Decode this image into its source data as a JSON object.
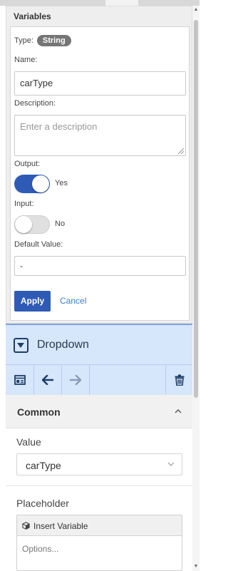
{
  "variables": {
    "section_title": "Variables",
    "type_label": "Type:",
    "type_value": "String",
    "name_label": "Name:",
    "name_value": "carType",
    "description_label": "Description:",
    "description_placeholder": "Enter a description",
    "output_label": "Output:",
    "output_state": "Yes",
    "input_label": "Input:",
    "input_state": "No",
    "default_label": "Default Value:",
    "default_value": "-",
    "apply_label": "Apply",
    "cancel_label": "Cancel"
  },
  "widget": {
    "title": "Dropdown",
    "icon": "dropdown-icon",
    "toolbar": [
      {
        "icon": "properties-icon"
      },
      {
        "icon": "arrow-left-icon"
      },
      {
        "icon": "arrow-right-icon"
      },
      {
        "icon": "trash-icon"
      }
    ]
  },
  "common": {
    "title": "Common",
    "value_label": "Value",
    "value_selected": "carType",
    "placeholder_label": "Placeholder",
    "insert_variable_label": "Insert Variable",
    "options_placeholder": "Options..."
  },
  "colors": {
    "primary": "#2f5bb7",
    "link": "#3a7bd5",
    "widget_header_bg": "#d6e6fb",
    "badge_bg": "#757575"
  }
}
